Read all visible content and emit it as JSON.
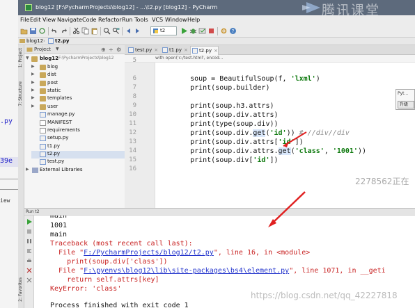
{
  "colors": {
    "titlebar": "#5d6a7c",
    "accent_arrow": "#e02020",
    "string_green": "#0f7a0f",
    "error_red": "#c82222",
    "link_blue": "#2233cc"
  },
  "background_fragments": [
    ".py",
    "39e",
    "iew"
  ],
  "window": {
    "title": "blog12 [F:\\PycharmProjects\\blog12] - ...\\t2.py [blog12] - PyCharm",
    "watermark_text": "腾讯课堂"
  },
  "menu": [
    "File",
    "Edit",
    "View",
    "Navigate",
    "Code",
    "Refactor",
    "Run",
    "Tools",
    "VCS",
    "Window",
    "Help"
  ],
  "toolbar": {
    "run_config": "t2"
  },
  "breadcrumb": [
    "blog12",
    "t2.py"
  ],
  "side_tabs": [
    "1: Project",
    "7: Structure",
    "2: Favorites"
  ],
  "project_panel": {
    "title": "Project",
    "root_name": "blog12",
    "root_path": "F:\\PycharmProjects\\blog12",
    "folders": [
      "blog",
      "dist",
      "post",
      "static",
      "templates",
      "user"
    ],
    "files": [
      "manage.py",
      "MANIFEST",
      "requirements",
      "setup.py",
      "t1.py",
      "t2.py",
      "test.py"
    ],
    "external": "External Libraries"
  },
  "editor": {
    "tabs": [
      "test.py",
      "t1.py",
      "t2.py"
    ],
    "active_tab": "t2.py",
    "crumb": "with open('c:/test.html', encod...",
    "line_numbers": [
      "5",
      "6",
      "7",
      "8",
      "9",
      "10",
      "11",
      "12",
      "13",
      "14",
      "15",
      "16"
    ],
    "lines": {
      "l6_a": "    soup = BeautifulSoup(f, ",
      "l6_s": "'lxml'",
      "l6_b": ")",
      "l7": "    print(soup.builder)",
      "l9": "    print(soup.h3.attrs)",
      "l10": "    print(soup.div.attrs)",
      "l11": "    print(type(soup.div))",
      "l12_a": "    print(soup.div.",
      "l12_get": "get",
      "l12_b": "(",
      "l12_s": "'id'",
      "l12_c": ")) ",
      "l12_cm": "# //div//div",
      "l13_a": "    print(soup.div.attrs[",
      "l13_s": "'id'",
      "l13_b": "])",
      "l14_a": "    print(soup.div.attrs.",
      "l14_get": "get",
      "l14_b": "(",
      "l14_s1": "'class'",
      "l14_c": ", ",
      "l14_s2": "'1001'",
      "l14_d": "))",
      "l15_a": "    print(soup.div[",
      "l15_s": "'id'",
      "l15_b": "])"
    }
  },
  "popup": {
    "title": "Pyt...",
    "button": "升级"
  },
  "watermark_id": "2278562正在",
  "run_panel": {
    "header": "Run  t2",
    "lines": {
      "c0": "main",
      "c1": "1001",
      "c2": "main",
      "c3": "Traceback (most recent call last):",
      "c4_a": "  File \"",
      "c4_link": "F:/PycharmProjects/blog12/t2.py",
      "c4_b": "\", line 16, in <module>",
      "c5": "    print(soup.div['class'])",
      "c6_a": "  File \"",
      "c6_link": "F:\\pyenvs\\blog12\\lib\\site-packages\\bs4\\element.py",
      "c6_b": "\", line 1071, in __geti",
      "c7": "    return self.attrs[key]",
      "c8": "KeyError: 'class'",
      "c9": "Process finished with exit code 1"
    }
  },
  "watermark_url": "https://blog.csdn.net/qq_42227818"
}
